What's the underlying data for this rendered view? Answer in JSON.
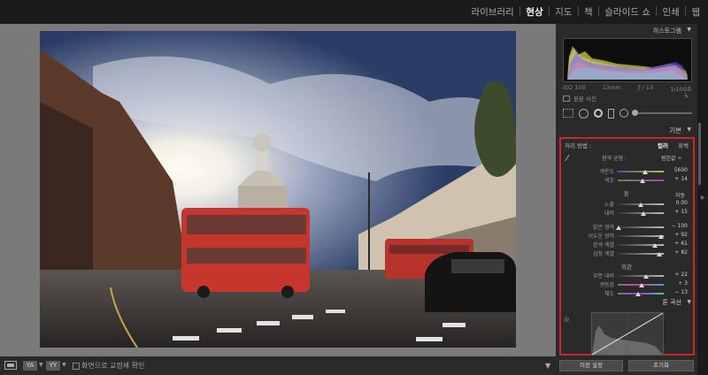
{
  "nav": {
    "modules": [
      {
        "label": "라이브러리",
        "active": false
      },
      {
        "label": "현상",
        "active": true
      },
      {
        "label": "지도",
        "active": false
      },
      {
        "label": "책",
        "active": false
      },
      {
        "label": "슬라이드 쇼",
        "active": false
      },
      {
        "label": "인쇄",
        "active": false
      },
      {
        "label": "웹",
        "active": false
      }
    ]
  },
  "toolbar": {
    "compare_a": "YA",
    "compare_b": "YY",
    "soft_proof_label": "화면으로 교정쇄 확인"
  },
  "histogram": {
    "title": "히스토그램",
    "iso": "ISO 100",
    "focal": "13mm",
    "aperture": "ƒ / 13",
    "shutter": "1/100초",
    "original_photo": "원본 사진"
  },
  "basic": {
    "title": "기본",
    "treatment_label": "처리 방법 :",
    "treatment_color": "컬러",
    "treatment_bw": "흑백",
    "wb_label": "흰색 균형 :",
    "wb_value": "원본값 ÷",
    "temp": {
      "label": "색온도",
      "value": "5600",
      "position": 0.6
    },
    "tint": {
      "label": "색조",
      "value": "+ 14",
      "position": 0.55
    },
    "tone_label": "톤",
    "tone_auto": "자동",
    "exposure": {
      "label": "노출",
      "value": "0.00",
      "position": 0.5
    },
    "contrast": {
      "label": "대비",
      "value": "+ 15",
      "position": 0.57
    },
    "highlights": {
      "label": "밝은 영역",
      "value": "− 100",
      "position": 0.02
    },
    "shadows": {
      "label": "어두운 영역",
      "value": "+ 92",
      "position": 0.95
    },
    "whites": {
      "label": "흰색 계열",
      "value": "+ 61",
      "position": 0.8
    },
    "blacks": {
      "label": "검정 계열",
      "value": "+ 82",
      "position": 0.9
    },
    "presence_label": "외관",
    "clarity": {
      "label": "부분 대비",
      "value": "+ 22",
      "position": 0.62
    },
    "vibrance": {
      "label": "생동감",
      "value": "+ 3",
      "position": 0.52
    },
    "saturation": {
      "label": "채도",
      "value": "− 13",
      "position": 0.43
    }
  },
  "tone_curve": {
    "title": "톤 곡선"
  },
  "buttons": {
    "previous": "이전 설정",
    "reset": "초기화"
  }
}
